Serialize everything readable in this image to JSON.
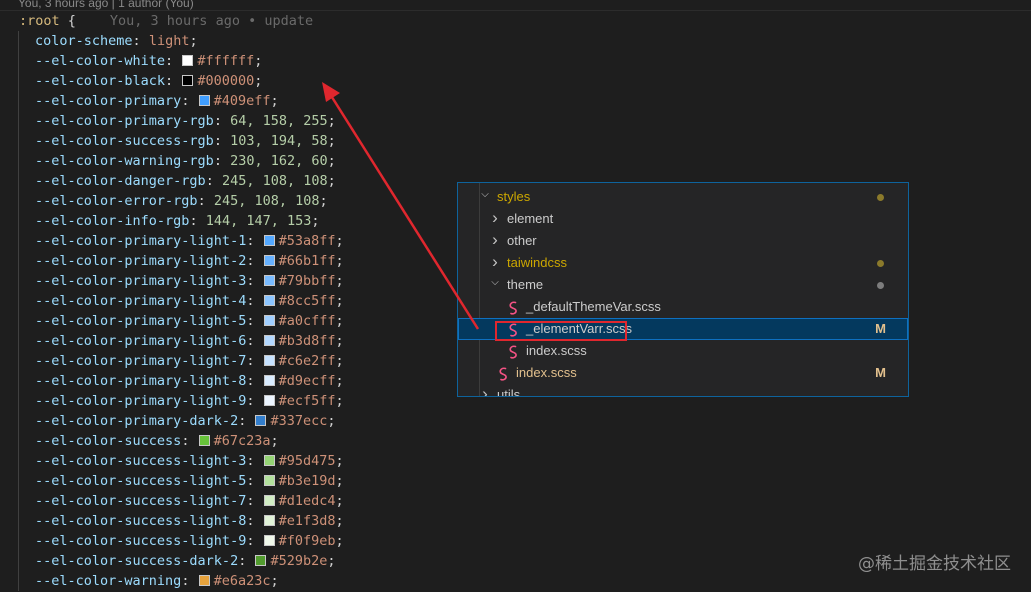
{
  "blame_header": "You, 3 hours ago | 1 author (You)",
  "code": {
    "selector": ":root",
    "open_brace": " {",
    "inline_blame": "You, 3 hours ago • update",
    "lines": [
      {
        "prop": "color-scheme",
        "value": "light",
        "kind": "keyword"
      },
      {
        "prop": "--el-color-white",
        "value": "#ffffff",
        "kind": "color",
        "swatch": "#ffffff"
      },
      {
        "prop": "--el-color-black",
        "value": "#000000",
        "kind": "color",
        "swatch": "#000000"
      },
      {
        "prop": "--el-color-primary",
        "value": "#409eff",
        "kind": "color",
        "swatch": "#409eff"
      },
      {
        "prop": "--el-color-primary-rgb",
        "value": "64, 158, 255",
        "kind": "number"
      },
      {
        "prop": "--el-color-success-rgb",
        "value": "103, 194, 58",
        "kind": "number"
      },
      {
        "prop": "--el-color-warning-rgb",
        "value": "230, 162, 60",
        "kind": "number"
      },
      {
        "prop": "--el-color-danger-rgb",
        "value": "245, 108, 108",
        "kind": "number"
      },
      {
        "prop": "--el-color-error-rgb",
        "value": "245, 108, 108",
        "kind": "number"
      },
      {
        "prop": "--el-color-info-rgb",
        "value": "144, 147, 153",
        "kind": "number"
      },
      {
        "prop": "--el-color-primary-light-1",
        "value": "#53a8ff",
        "kind": "color",
        "swatch": "#53a8ff"
      },
      {
        "prop": "--el-color-primary-light-2",
        "value": "#66b1ff",
        "kind": "color",
        "swatch": "#66b1ff"
      },
      {
        "prop": "--el-color-primary-light-3",
        "value": "#79bbff",
        "kind": "color",
        "swatch": "#79bbff"
      },
      {
        "prop": "--el-color-primary-light-4",
        "value": "#8cc5ff",
        "kind": "color",
        "swatch": "#8cc5ff"
      },
      {
        "prop": "--el-color-primary-light-5",
        "value": "#a0cfff",
        "kind": "color",
        "swatch": "#a0cfff"
      },
      {
        "prop": "--el-color-primary-light-6",
        "value": "#b3d8ff",
        "kind": "color",
        "swatch": "#b3d8ff"
      },
      {
        "prop": "--el-color-primary-light-7",
        "value": "#c6e2ff",
        "kind": "color",
        "swatch": "#c6e2ff"
      },
      {
        "prop": "--el-color-primary-light-8",
        "value": "#d9ecff",
        "kind": "color",
        "swatch": "#d9ecff"
      },
      {
        "prop": "--el-color-primary-light-9",
        "value": "#ecf5ff",
        "kind": "color",
        "swatch": "#ecf5ff"
      },
      {
        "prop": "--el-color-primary-dark-2",
        "value": "#337ecc",
        "kind": "color",
        "swatch": "#337ecc"
      },
      {
        "prop": "--el-color-success",
        "value": "#67c23a",
        "kind": "color",
        "swatch": "#67c23a"
      },
      {
        "prop": "--el-color-success-light-3",
        "value": "#95d475",
        "kind": "color",
        "swatch": "#95d475"
      },
      {
        "prop": "--el-color-success-light-5",
        "value": "#b3e19d",
        "kind": "color",
        "swatch": "#b3e19d"
      },
      {
        "prop": "--el-color-success-light-7",
        "value": "#d1edc4",
        "kind": "color",
        "swatch": "#d1edc4"
      },
      {
        "prop": "--el-color-success-light-8",
        "value": "#e1f3d8",
        "kind": "color",
        "swatch": "#e1f3d8"
      },
      {
        "prop": "--el-color-success-light-9",
        "value": "#f0f9eb",
        "kind": "color",
        "swatch": "#f0f9eb"
      },
      {
        "prop": "--el-color-success-dark-2",
        "value": "#529b2e",
        "kind": "color",
        "swatch": "#529b2e"
      },
      {
        "prop": "--el-color-warning",
        "value": "#e6a23c",
        "kind": "color",
        "swatch": "#e6a23c"
      }
    ]
  },
  "explorer": {
    "items": [
      {
        "label": "styles",
        "type": "folder-open",
        "depth": 0,
        "color": "#cca700",
        "dot": "#8b7a2b"
      },
      {
        "label": "element",
        "type": "folder",
        "depth": 1
      },
      {
        "label": "other",
        "type": "folder",
        "depth": 1
      },
      {
        "label": "taiwindcss",
        "type": "folder",
        "depth": 1,
        "color": "#cca700",
        "dot": "#8b7a2b"
      },
      {
        "label": "theme",
        "type": "folder-open",
        "depth": 1,
        "dot": "#7d7d7d"
      },
      {
        "label": "_defaultThemeVar.scss",
        "type": "file",
        "depth": 2
      },
      {
        "label": "_elementVarr.scss",
        "type": "file",
        "depth": 2,
        "selected": true,
        "badge": "M"
      },
      {
        "label": "index.scss",
        "type": "file",
        "depth": 2
      },
      {
        "label": "index.scss",
        "type": "file",
        "depth": 1,
        "color": "#e2c08d",
        "badge": "M"
      },
      {
        "label": "utils",
        "type": "folder",
        "depth": 0
      }
    ]
  },
  "watermark": "@稀土掘金技术社区",
  "colors": {
    "accent": "#0e639c",
    "annotation": "#e0272e",
    "modified": "#e2c08d",
    "sass_icon": "#f55385"
  }
}
